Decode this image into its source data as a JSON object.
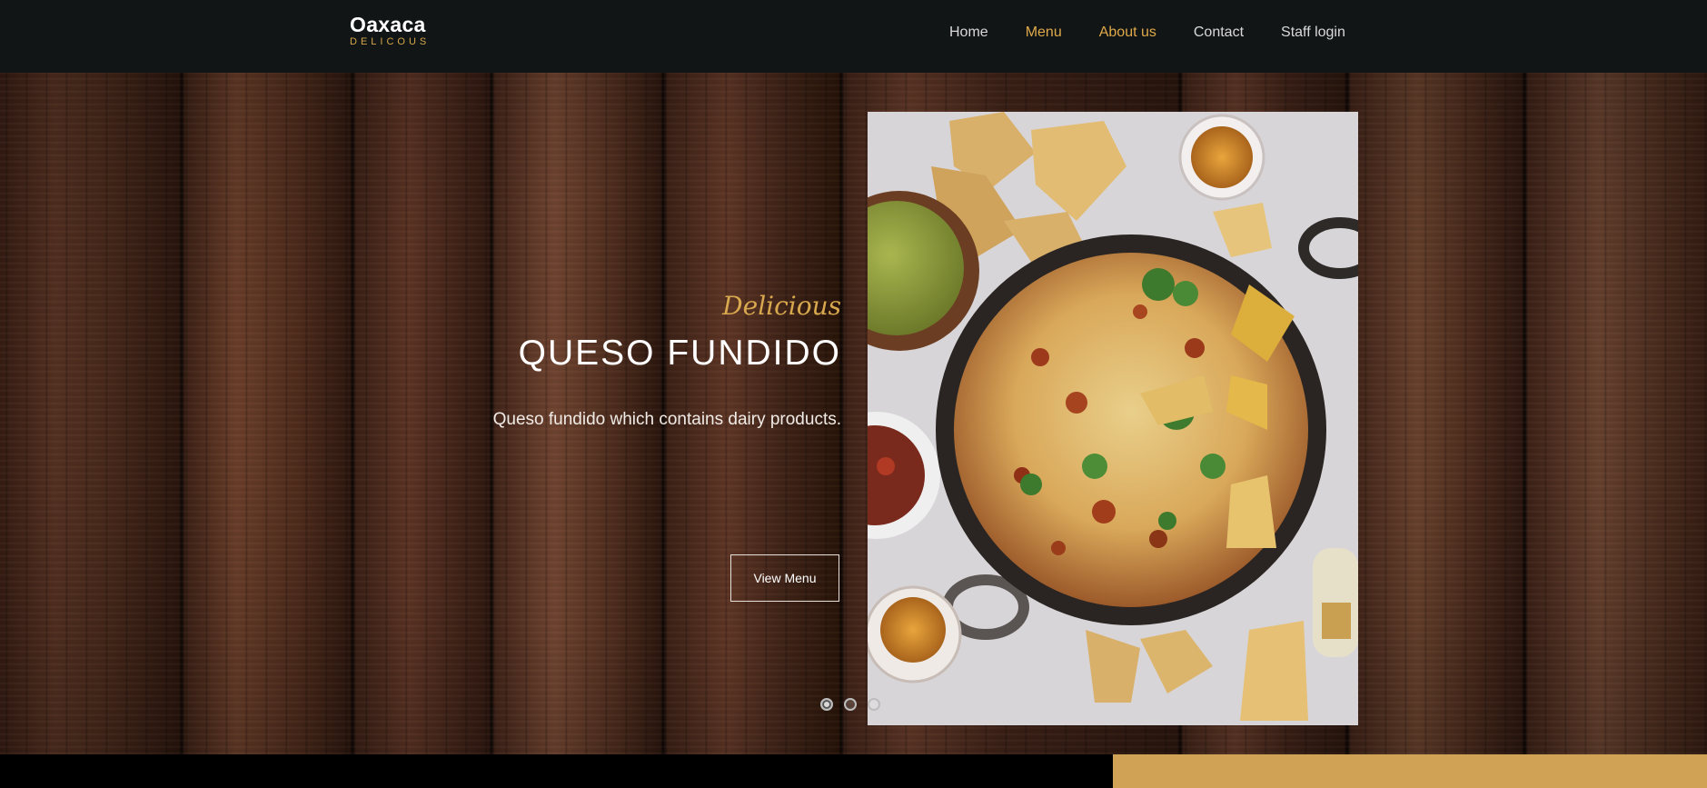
{
  "brand": {
    "name": "Oaxaca",
    "subtitle": "DELICOUS"
  },
  "nav": {
    "items": [
      {
        "label": "Home",
        "active": false
      },
      {
        "label": "Menu",
        "active": true
      },
      {
        "label": "About us",
        "active": true
      },
      {
        "label": "Contact",
        "active": false
      },
      {
        "label": "Staff login",
        "active": false
      }
    ]
  },
  "hero": {
    "tagline": "Delicious",
    "title": "QUESO FUNDIDO",
    "description": "Queso fundido which contains dairy products.",
    "button_label": "View Menu",
    "slide_count": 3,
    "active_slide": 1
  },
  "colors": {
    "accent": "#d6a64a",
    "navbar": "#111516",
    "footer_accent": "#cfa255"
  },
  "icons": [
    "slide-dot-icon"
  ]
}
